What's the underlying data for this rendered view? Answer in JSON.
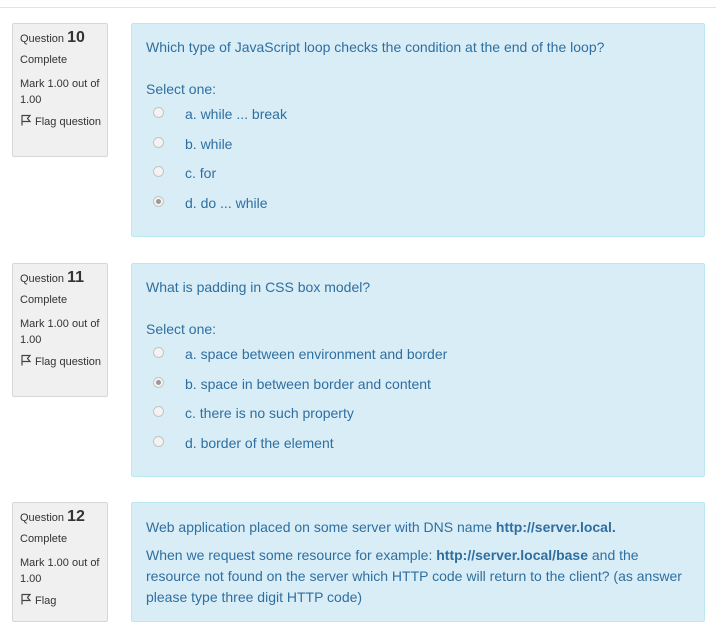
{
  "questions": [
    {
      "label": "Question",
      "number": "10",
      "state": "Complete",
      "grade": "Mark 1.00 out of 1.00",
      "flag": "Flag question",
      "text": "Which type of JavaScript loop checks the condition at the end of the loop?",
      "prompt": "Select one:",
      "answers": [
        {
          "label": "a. while ... break",
          "checked": false
        },
        {
          "label": "b. while",
          "checked": false
        },
        {
          "label": "c. for",
          "checked": false
        },
        {
          "label": "d. do ... while",
          "checked": true
        }
      ]
    },
    {
      "label": "Question",
      "number": "11",
      "state": "Complete",
      "grade": "Mark 1.00 out of 1.00",
      "flag": "Flag question",
      "text": "What is padding in CSS box model?",
      "prompt": "Select one:",
      "answers": [
        {
          "label": "a. space between environment and border",
          "checked": false
        },
        {
          "label": "b. space in between border and content",
          "checked": true
        },
        {
          "label": "c. there is no such property",
          "checked": false
        },
        {
          "label": "d. border of the element",
          "checked": false
        }
      ]
    },
    {
      "label": "Question",
      "number": "12",
      "state": "Complete",
      "grade": "Mark 1.00 out of 1.00",
      "flag": "Flag",
      "text_prefix": "Web application placed on some server with DNS name ",
      "text_domain": "http://server.local.",
      "request_prefix": "When we request some resource for example: ",
      "request_url": "http://server.local/base",
      "request_suffix": " and the resource not found on the server which HTTP code will return to the client? (as answer please type three digit HTTP code)"
    }
  ],
  "colors": {
    "content_background": "#d9edf7",
    "content_text": "#2f6f9f",
    "info_background": "#f0f0f0"
  },
  "icons": {
    "flag": "flag-icon",
    "radio": "radio-button"
  }
}
